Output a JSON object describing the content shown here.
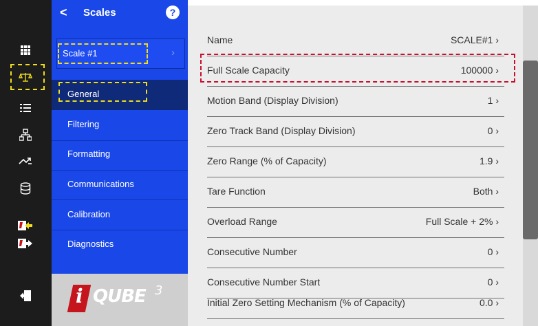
{
  "nav": {
    "icons": [
      "grid-icon",
      "scale-balance-icon",
      "list-icon",
      "network-icon",
      "route-icon",
      "database-icon",
      "import-icon",
      "export-icon",
      "logout-icon"
    ]
  },
  "sidebar": {
    "back_symbol": "<",
    "title": "Scales",
    "help_symbol": "?",
    "selector": {
      "label": "Scale #1",
      "arrow": "›"
    },
    "items": [
      {
        "label": "General",
        "active": true
      },
      {
        "label": "Filtering"
      },
      {
        "label": "Formatting"
      },
      {
        "label": "Communications"
      },
      {
        "label": "Calibration"
      },
      {
        "label": "Diagnostics"
      }
    ],
    "logo": {
      "mark": "i",
      "word": "QUBE",
      "sup": "3"
    }
  },
  "settings": {
    "rows": [
      {
        "name": "Name",
        "value": "SCALE#1",
        "arrow": "›"
      },
      {
        "name": "Full Scale Capacity",
        "value": "100000",
        "arrow": "›"
      },
      {
        "name": "Motion Band (Display Division)",
        "value": "1",
        "arrow": "›"
      },
      {
        "name": "Zero Track Band (Display Division)",
        "value": "0",
        "arrow": "›"
      },
      {
        "name": "Zero Range (% of Capacity)",
        "value": "1.9",
        "arrow": "›"
      },
      {
        "name": "Tare Function",
        "value": "Both",
        "arrow": "›"
      },
      {
        "name": "Overload Range",
        "value": "Full Scale + 2%",
        "arrow": "›"
      },
      {
        "name": "Consecutive Number",
        "value": "0",
        "arrow": "›"
      },
      {
        "name": "Consecutive Number Start",
        "value": "0",
        "arrow": "›"
      },
      {
        "name": "Initial Zero Setting Mechanism (% of Capacity)",
        "value": "0.0",
        "arrow": "›"
      }
    ]
  },
  "colors": {
    "sidebar_blue": "#1a47e8",
    "highlight_yellow": "#f0dd1e",
    "highlight_red": "#c8102e",
    "logo_red": "#c4161c"
  }
}
